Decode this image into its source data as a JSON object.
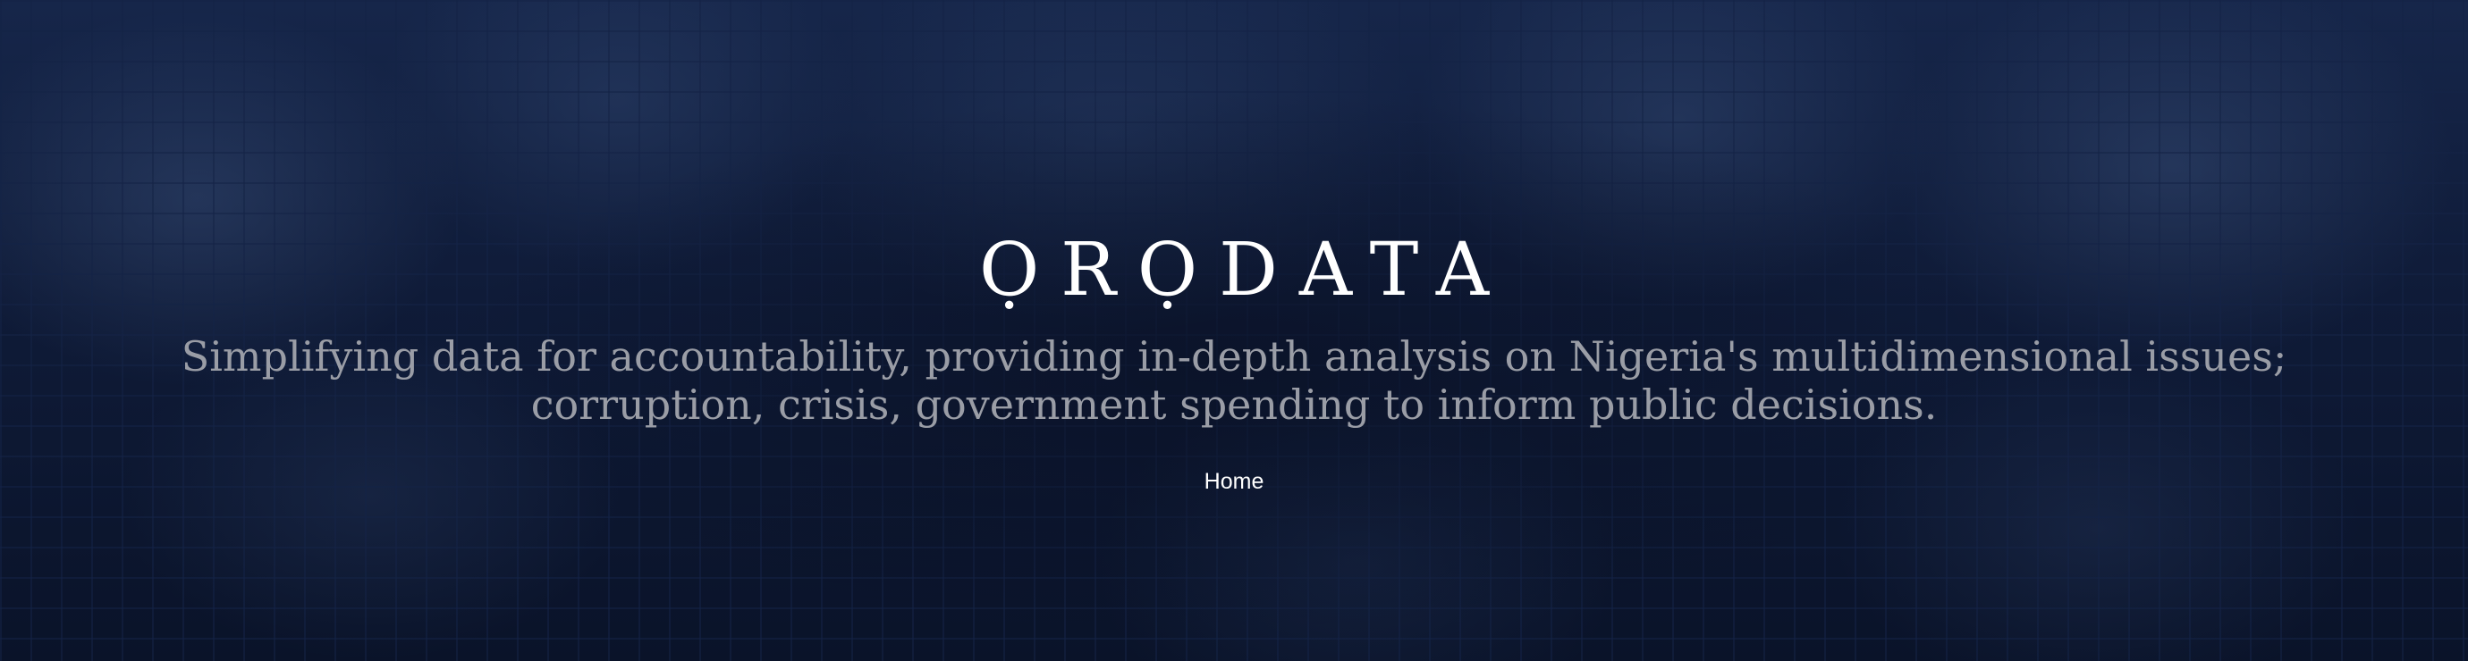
{
  "hero": {
    "logo_text": "ỌRỌDATA",
    "tagline_line1": "Simplifying data for accountability, providing in-depth analysis on Nigeria's multidimensional issues;",
    "tagline_line2": "corruption, crisis, government spending to inform public decisions."
  },
  "nav": {
    "home_label": "Home"
  },
  "colors": {
    "background": "#0f1b38",
    "logo": "#ffffff",
    "tagline": "#9a9da6",
    "nav_link": "#ffffff"
  }
}
